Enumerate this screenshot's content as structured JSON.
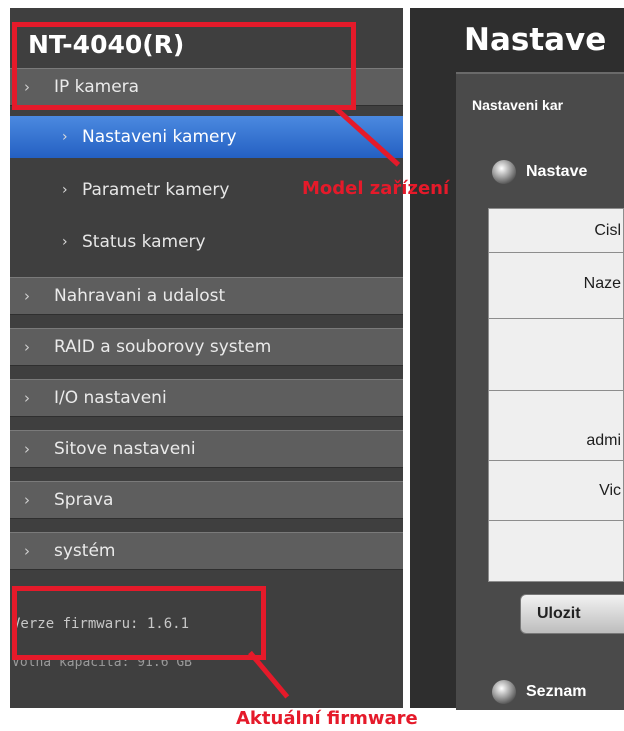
{
  "device": {
    "model": "NT-4040(R)"
  },
  "sidebar": {
    "menu": [
      {
        "label": "IP kamera"
      },
      {
        "label": "Nahravani a udalost"
      },
      {
        "label": "RAID a souborovy system"
      },
      {
        "label": "I/O nastaveni"
      },
      {
        "label": "Sitove nastaveni"
      },
      {
        "label": "Sprava"
      },
      {
        "label": "systém"
      }
    ],
    "submenu": [
      {
        "label": "Nastaveni kamery",
        "active": true
      },
      {
        "label": "Parametr kamery"
      },
      {
        "label": "Status kamery"
      }
    ],
    "firmware_text": "Verze firmwaru: 1.6.1",
    "capacity_text": "Volna kapacita: 91.6 GB"
  },
  "right": {
    "title": "Nastave",
    "subtitle": "Nastaveni kar",
    "section1": "Nastave",
    "table_rows": [
      "Cisl",
      "Naze",
      "",
      "admi",
      "Vic",
      ""
    ],
    "save_label": "Ulozit",
    "section2": "Seznam"
  },
  "annotations": {
    "model_label": "Model zařízení",
    "firmware_label": "Aktuální firmware",
    "color": "#e51a2a"
  },
  "icons": {
    "chevron": "chevron-right-icon",
    "orb": "radio-orb-icon"
  }
}
